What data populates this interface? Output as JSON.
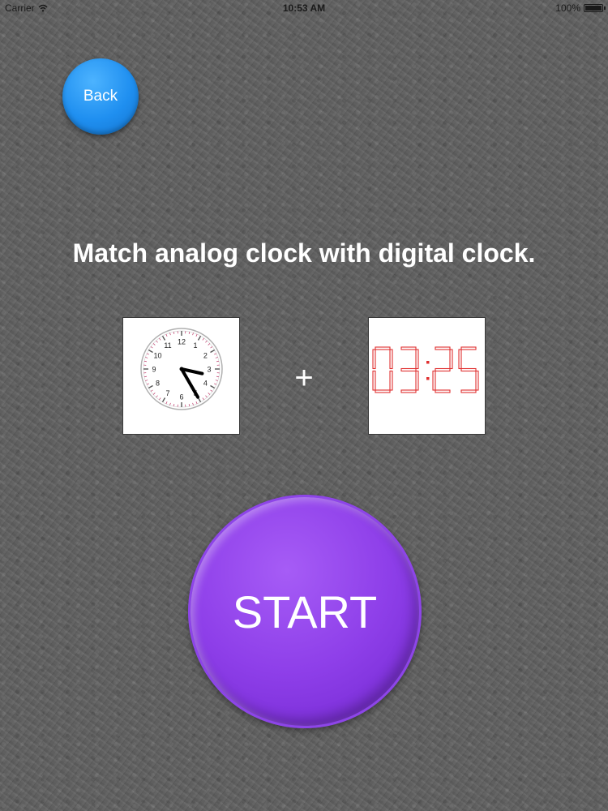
{
  "status_bar": {
    "carrier": "Carrier",
    "time": "10:53 AM",
    "battery": "100%"
  },
  "back_button": {
    "label": "Back"
  },
  "instruction": "Match analog clock with digital clock.",
  "analog_clock": {
    "numbers": [
      "12",
      "1",
      "2",
      "3",
      "4",
      "5",
      "6",
      "7",
      "8",
      "9",
      "10",
      "11"
    ],
    "hour": 3,
    "minute": 25
  },
  "plus_sign": "+",
  "digital_clock": {
    "display": "03:25",
    "color": "#e03030"
  },
  "start_button": {
    "label": "START",
    "color": "#8e3fe9"
  }
}
